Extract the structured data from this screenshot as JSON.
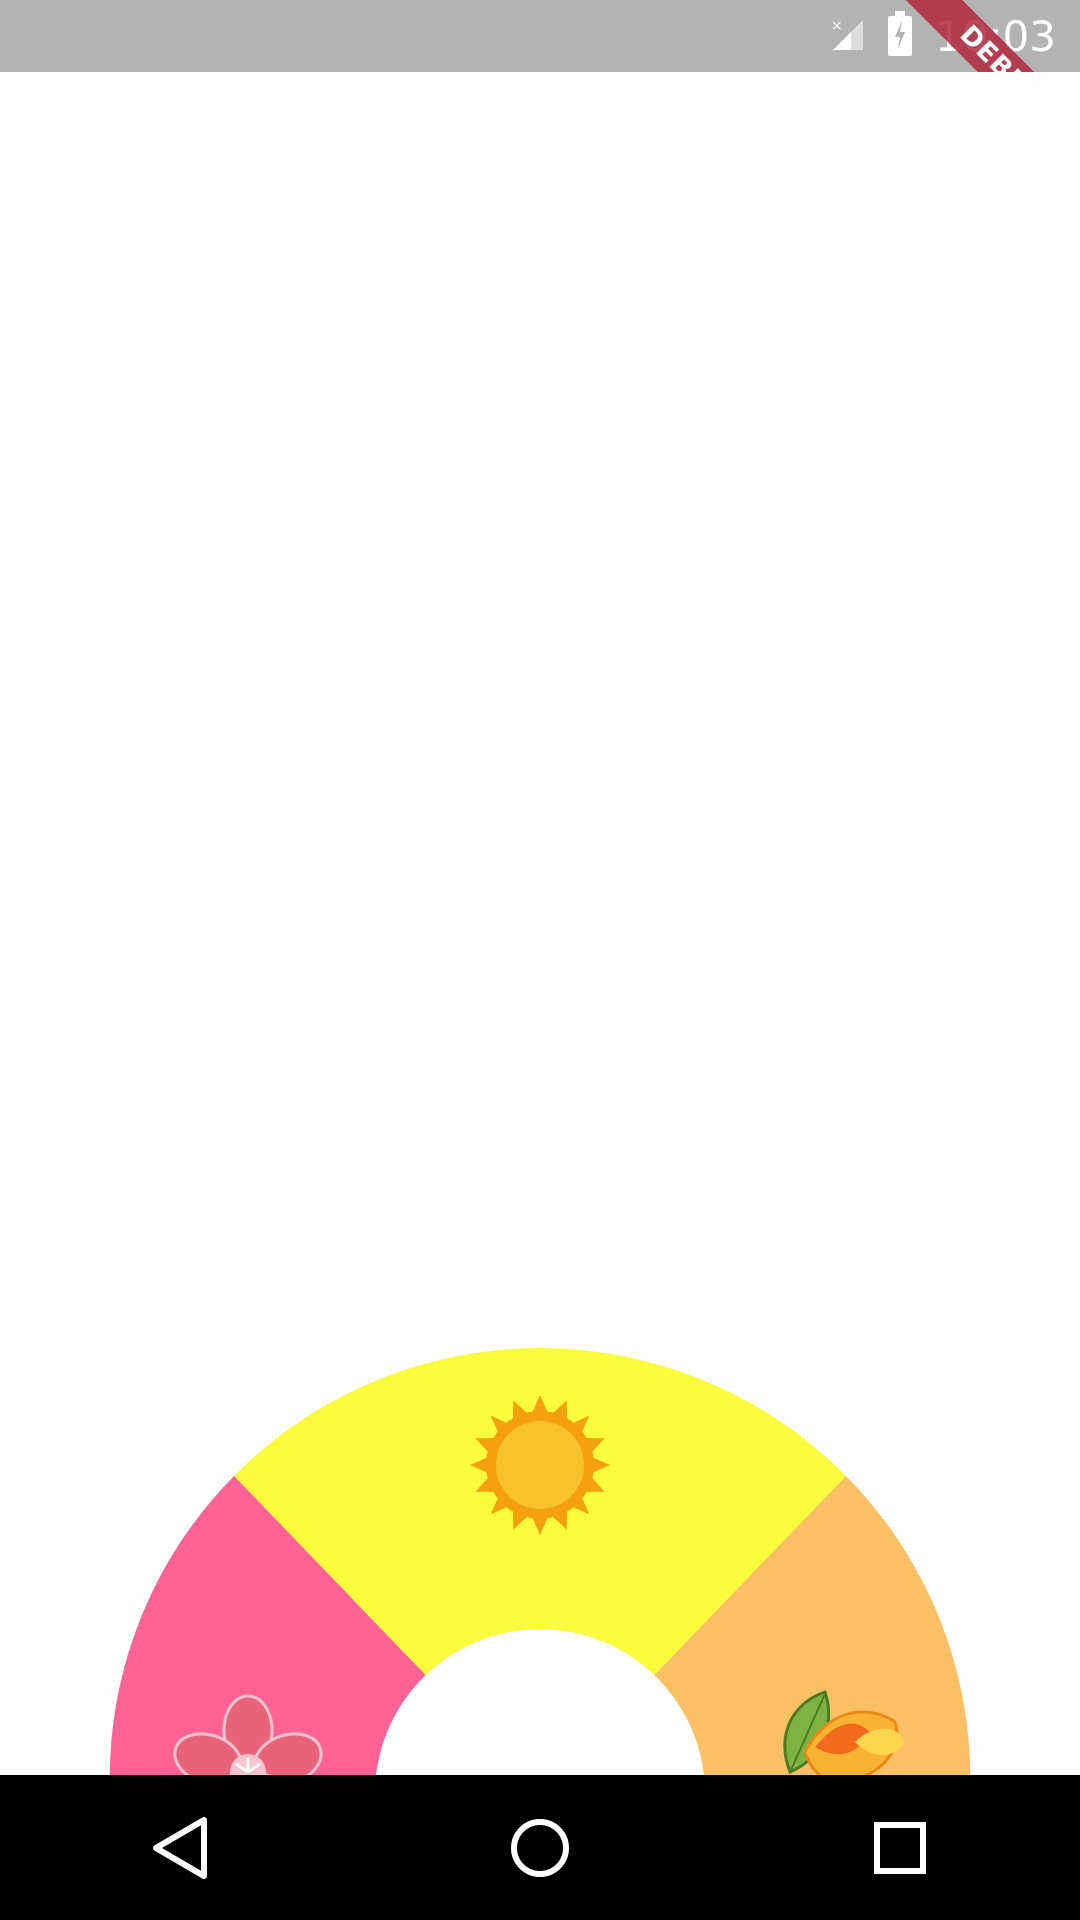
{
  "status_bar": {
    "time": "10:03",
    "icons": [
      "signal-off-icon",
      "battery-charging-icon"
    ]
  },
  "debug_banner": {
    "label": "DEBUG"
  },
  "season_wheel": {
    "segments": [
      {
        "name": "summer",
        "color": "#FBFC3C",
        "icon": "sun-icon"
      },
      {
        "name": "spring",
        "color": "#FF6395",
        "icon": "cherry-blossom-icon"
      },
      {
        "name": "autumn",
        "color": "#FCC064",
        "icon": "autumn-leaves-icon"
      }
    ],
    "center_color": "#FFFFFF"
  },
  "navigation_bar": {
    "buttons": [
      "back-icon",
      "home-icon",
      "recents-icon"
    ]
  }
}
